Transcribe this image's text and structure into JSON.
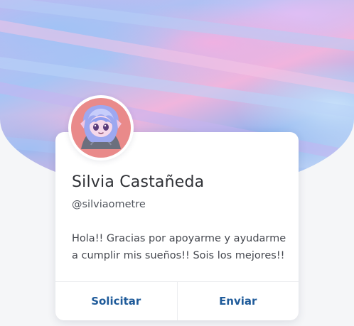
{
  "profile": {
    "name": "Silvia Castañeda",
    "handle": "@silviaometre",
    "bio": "Hola!! Gracias por apoyarme y ayudarme a cumplir mis sueños!! Sois los mejores!!"
  },
  "actions": {
    "request_label": "Solicitar",
    "send_label": "Enviar"
  },
  "colors": {
    "action_text": "#1f5b9a",
    "name_text": "#2f3136",
    "card_background": "#ffffff",
    "page_background": "#f5f6f8"
  }
}
